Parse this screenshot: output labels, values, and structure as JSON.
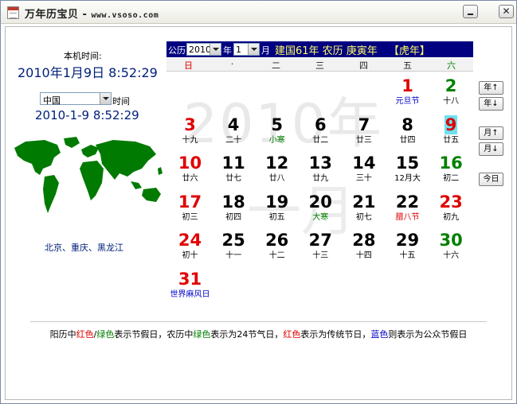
{
  "window": {
    "title": "万年历宝贝",
    "title_sep": " - ",
    "site": "www.vsoso.com",
    "close_glyph": "✕"
  },
  "local": {
    "label": "本机时间:",
    "datetime": "2010年1月9日  8:52:29"
  },
  "country": {
    "selected": "中国",
    "suffix": "时间",
    "datetime": "2010-1-9 8:52:29",
    "cities": "北京、重庆、黑龙江",
    "map_icon": "world-map",
    "map_color": "#007a00"
  },
  "toolbar": {
    "gongli_label": "公历",
    "year_value": "2010",
    "year_suffix": "年",
    "month_value": "1",
    "month_suffix": "月",
    "info": "建国61年  农历  庚寅年",
    "zodiac": "【虎年】",
    "bg_color": "#000080",
    "info_color": "#ffff66"
  },
  "weekdays": [
    "日",
    "·",
    "二",
    "三",
    "四",
    "五",
    "六"
  ],
  "watermark": {
    "year": "2010年",
    "month": "一月"
  },
  "colors": {
    "red": "#e00000",
    "green": "#008000",
    "black": "#000000",
    "blue": "#0000cc",
    "today": "#6ee0f0"
  },
  "calendar": {
    "weeks": [
      [
        null,
        null,
        null,
        null,
        null,
        {
          "day": "1",
          "sub": "元旦节",
          "dc": "red",
          "sc": "blue"
        },
        {
          "day": "2",
          "sub": "十八",
          "dc": "green",
          "sc": "black"
        }
      ],
      [
        {
          "day": "3",
          "sub": "十九",
          "dc": "red",
          "sc": "black"
        },
        {
          "day": "4",
          "sub": "二十",
          "dc": "black",
          "sc": "black"
        },
        {
          "day": "5",
          "sub": "小寒",
          "dc": "black",
          "sc": "green"
        },
        {
          "day": "6",
          "sub": "廿二",
          "dc": "black",
          "sc": "black"
        },
        {
          "day": "7",
          "sub": "廿三",
          "dc": "black",
          "sc": "black"
        },
        {
          "day": "8",
          "sub": "廿四",
          "dc": "black",
          "sc": "black"
        },
        {
          "day": "9",
          "sub": "廿五",
          "dc": "red",
          "sc": "black",
          "today": true
        }
      ],
      [
        {
          "day": "10",
          "sub": "廿六",
          "dc": "red",
          "sc": "black"
        },
        {
          "day": "11",
          "sub": "廿七",
          "dc": "black",
          "sc": "black"
        },
        {
          "day": "12",
          "sub": "廿八",
          "dc": "black",
          "sc": "black"
        },
        {
          "day": "13",
          "sub": "廿九",
          "dc": "black",
          "sc": "black"
        },
        {
          "day": "14",
          "sub": "三十",
          "dc": "black",
          "sc": "black"
        },
        {
          "day": "15",
          "sub": "12月大",
          "dc": "black",
          "sc": "black"
        },
        {
          "day": "16",
          "sub": "初二",
          "dc": "green",
          "sc": "black"
        }
      ],
      [
        {
          "day": "17",
          "sub": "初三",
          "dc": "red",
          "sc": "black"
        },
        {
          "day": "18",
          "sub": "初四",
          "dc": "black",
          "sc": "black"
        },
        {
          "day": "19",
          "sub": "初五",
          "dc": "black",
          "sc": "black"
        },
        {
          "day": "20",
          "sub": "大寒",
          "dc": "black",
          "sc": "green"
        },
        {
          "day": "21",
          "sub": "初七",
          "dc": "black",
          "sc": "black"
        },
        {
          "day": "22",
          "sub": "腊八节",
          "dc": "black",
          "sc": "red"
        },
        {
          "day": "23",
          "sub": "初九",
          "dc": "red",
          "sc": "black"
        }
      ],
      [
        {
          "day": "24",
          "sub": "初十",
          "dc": "red",
          "sc": "black"
        },
        {
          "day": "25",
          "sub": "十一",
          "dc": "black",
          "sc": "black"
        },
        {
          "day": "26",
          "sub": "十二",
          "dc": "black",
          "sc": "black"
        },
        {
          "day": "27",
          "sub": "十三",
          "dc": "black",
          "sc": "black"
        },
        {
          "day": "28",
          "sub": "十四",
          "dc": "black",
          "sc": "black"
        },
        {
          "day": "29",
          "sub": "十五",
          "dc": "black",
          "sc": "black"
        },
        {
          "day": "30",
          "sub": "十六",
          "dc": "green",
          "sc": "black"
        }
      ],
      [
        {
          "day": "31",
          "sub": "世界麻风日",
          "dc": "red",
          "sc": "blue"
        },
        null,
        null,
        null,
        null,
        null,
        null
      ]
    ]
  },
  "side_buttons": {
    "year_up": "年↑",
    "year_down": "年↓",
    "month_up": "月↑",
    "month_down": "月↓",
    "today": "今日"
  },
  "legend": {
    "p1": "阳历中",
    "red1": "红色",
    "slash": "/",
    "green1": "绿色",
    "p2": "表示节假日，农历中",
    "green2": "绿色",
    "p3": "表示为24节气日，",
    "red2": "红色",
    "p4": "表示为传统节日，",
    "blue1": "蓝色",
    "p5": "则表示为公众节假日"
  }
}
